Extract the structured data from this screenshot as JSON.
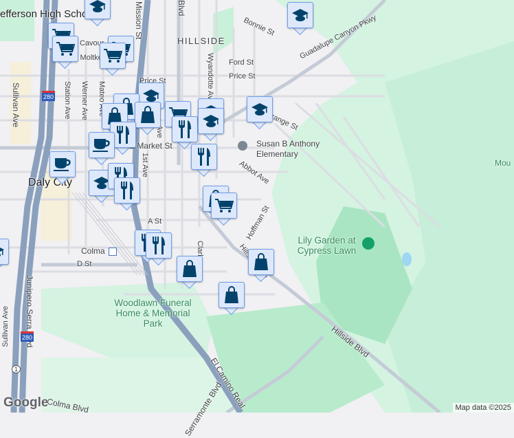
{
  "map": {
    "labels": {
      "jefferson": "efferson High School",
      "hillside": "HILLSIDE",
      "daly_city": "Daly City",
      "mission": "Mission St",
      "blvd": "Blvd",
      "wyandotte": "Wyandotte Ave",
      "bonnie": "Bonnie St",
      "ford": "Ford St",
      "price": "Price St",
      "price2": "Price St",
      "guadalupe": "Guadalupe Canyon Pkwy",
      "cavour": "Cavour",
      "moltke": "W Moltke",
      "sullivan": "Sullivan Ave",
      "station": "Station Ave",
      "werner": "Werner Ave",
      "mateo": "Mateo Ave",
      "emarket": "E Market St",
      "first": "1st Ave",
      "ave": "Ave",
      "orange": "Orange St",
      "susan": "Susan B Anthony Elementary",
      "abbot": "Abbot Ave",
      "hoffman": "Hoffman St",
      "ast": "A St",
      "dst": "D St",
      "colma": "Colma",
      "clark": "Clark",
      "hillside_blvd": "Hillside Blvd",
      "hillside_blvd2": "Hillside Blvd",
      "lily": "Lily Garden at Cypress Lawn",
      "woodlawn": "Woodlawn Funeral Home & Memorial Park",
      "junipero": "Junipero Serra Blvd",
      "sullivan2": "Sullivan Ave",
      "el_camino": "El Camino Real",
      "serramonte": "Serramonte Blvd",
      "colma_blvd": "Colma Blvd",
      "mount": "Mou",
      "i280": "280",
      "i280b": "280",
      "route1": "1"
    },
    "markers": [
      "school",
      "cart",
      "cart",
      "cart",
      "cart",
      "school",
      "bag",
      "bag",
      "bag",
      "fork",
      "cup",
      "cup",
      "school",
      "fork",
      "fork",
      "cart",
      "fork",
      "school",
      "school",
      "fork",
      "school",
      "school",
      "bag",
      "cart",
      "fork",
      "fork",
      "bag",
      "bag",
      "bag",
      "school"
    ],
    "google_logo": "Google",
    "attribution": "Map data ©2025"
  },
  "colors": {
    "park": "#c9f0d9",
    "park_dark": "#a8e6c1",
    "highway": "#8aa0bd",
    "marker_fill": "#dde8fb",
    "marker_icon": "#03436b"
  }
}
